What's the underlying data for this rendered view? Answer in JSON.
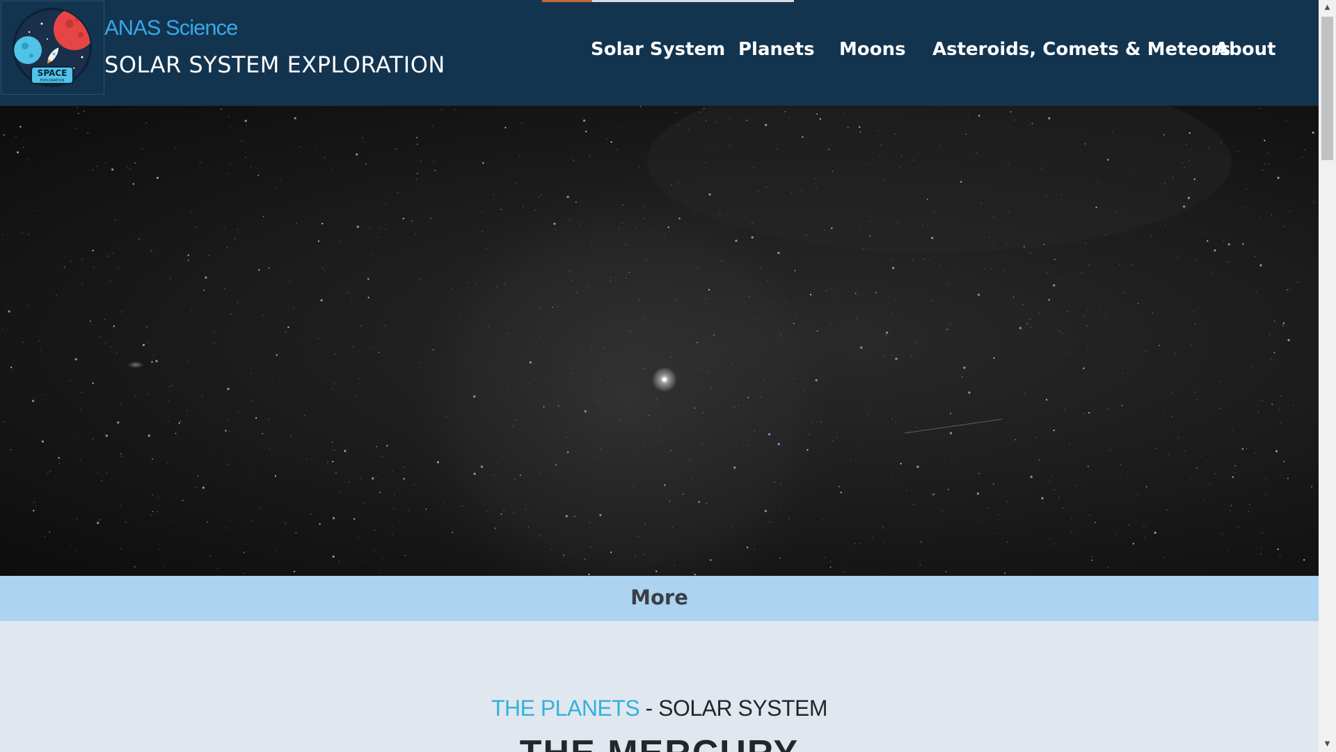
{
  "header": {
    "brand_name": "ANAS Science",
    "brand_subtitle": "SOLAR SYSTEM EXPLORATION",
    "logo_text": "SPACE",
    "logo_subtext": "EXPLORATION",
    "load_progress": 0.2,
    "nav": [
      {
        "label": "Solar System"
      },
      {
        "label": "Planets"
      },
      {
        "label": "Moons"
      },
      {
        "label": "Asteroids, Comets & Meteors"
      },
      {
        "label": "About"
      }
    ]
  },
  "more_bar": {
    "label": "More"
  },
  "section": {
    "heading_accent": "THE PLANETS",
    "heading_separator": "-",
    "heading_main": "SOLAR SYSTEM",
    "planet_title": "THE MERCURY"
  },
  "colors": {
    "header_bg": "#13344f",
    "brand_accent": "#38a8e8",
    "more_bar_bg": "#acd3ef",
    "heading_accent": "#31b2dc",
    "content_bg": "#e1e7ef"
  },
  "icons": {
    "logo": "space-exploration-badge-icon",
    "scroll_up": "scroll-up-arrow-icon",
    "scroll_down": "scroll-down-arrow-icon"
  }
}
